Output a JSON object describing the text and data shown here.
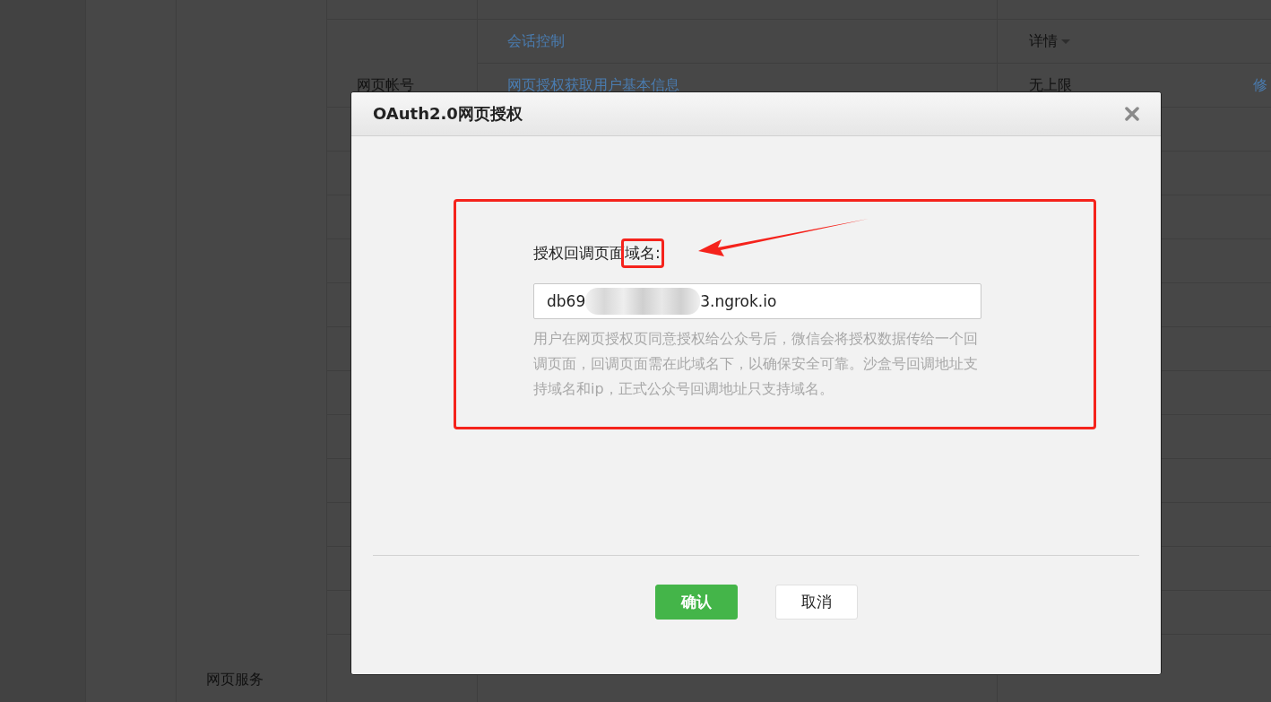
{
  "background_table": {
    "rows": [
      {
        "group": "",
        "name": "会话控制",
        "quota": "详情",
        "quota_dropdown": true,
        "action": ""
      },
      {
        "group": "网页帐号",
        "name": "网页授权获取用户基本信息",
        "quota": "无上限",
        "quota_dropdown": false,
        "action": "修"
      }
    ],
    "section": "网页服务"
  },
  "dialog": {
    "title": "OAuth2.0网页授权",
    "label": "授权回调页面",
    "highlighted_label": "域名:",
    "field": {
      "value_start": "db69",
      "value_end": "3.ngrok.io",
      "redacted": true
    },
    "help": "用户在网页授权页同意授权给公众号后，微信会将授权数据传给一个回调页面，回调页面需在此域名下，以确保安全可靠。沙盒号回调地址支持域名和ip，正式公众号回调地址只支持域名。",
    "buttons": [
      {
        "label": "确认",
        "kind": "primary"
      },
      {
        "label": "取消",
        "kind": "secondary"
      }
    ]
  }
}
